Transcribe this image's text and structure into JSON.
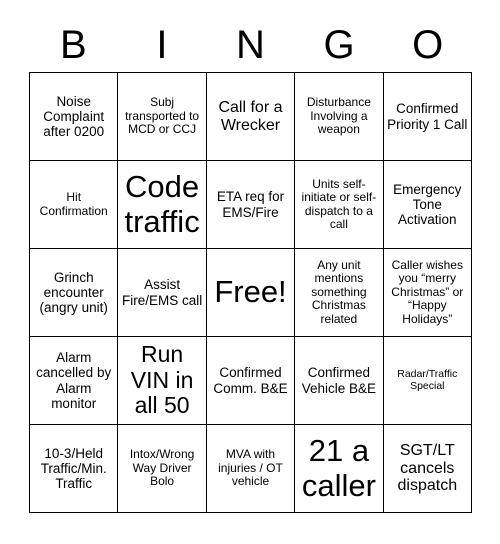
{
  "card": {
    "header_letters": [
      "B",
      "I",
      "N",
      "G",
      "O"
    ],
    "free_space_label": "Free!",
    "columns": [
      "B",
      "I",
      "N",
      "G",
      "O"
    ],
    "rows": [
      [
        {
          "text": "Noise Complaint after 0200",
          "size": "md"
        },
        {
          "text": "Subj transported to MCD or CCJ",
          "size": "sm"
        },
        {
          "text": "Call for a Wrecker",
          "size": "lg"
        },
        {
          "text": "Disturbance Involving a weapon",
          "size": "sm"
        },
        {
          "text": "Confirmed Priority 1 Call",
          "size": "md"
        }
      ],
      [
        {
          "text": "Hit Confirmation",
          "size": "sm"
        },
        {
          "text": "Code traffic",
          "size": "xxl"
        },
        {
          "text": "ETA req for EMS/Fire",
          "size": "md"
        },
        {
          "text": "Units self-initiate or self-dispatch to a call",
          "size": "sm"
        },
        {
          "text": "Emergency Tone Activation",
          "size": "md"
        }
      ],
      [
        {
          "text": "Grinch encounter (angry unit)",
          "size": "md"
        },
        {
          "text": "Assist Fire/EMS call",
          "size": "md"
        },
        {
          "text": "Free!",
          "size": "xxl"
        },
        {
          "text": "Any unit mentions something Christmas related",
          "size": "sm"
        },
        {
          "text": "Caller wishes you “merry Christmas” or “Happy Holidays”",
          "size": "sm"
        }
      ],
      [
        {
          "text": "Alarm cancelled by Alarm monitor",
          "size": "md"
        },
        {
          "text": "Run VIN in all 50",
          "size": "xl"
        },
        {
          "text": "Confirmed Comm. B&E",
          "size": "md"
        },
        {
          "text": "Confirmed Vehicle B&E",
          "size": "md"
        },
        {
          "text": "Radar/Traffic Special",
          "size": "xs"
        }
      ],
      [
        {
          "text": "10-3/Held Traffic/Min. Traffic",
          "size": "md"
        },
        {
          "text": "Intox/Wrong Way Driver Bolo",
          "size": "sm"
        },
        {
          "text": "MVA with injuries / OT vehicle",
          "size": "sm"
        },
        {
          "text": "21 a caller",
          "size": "xxl"
        },
        {
          "text": "SGT/LT cancels dispatch",
          "size": "lg"
        }
      ]
    ]
  },
  "colors": {
    "background": "#ffffff",
    "text": "#000000",
    "border": "#000000"
  }
}
